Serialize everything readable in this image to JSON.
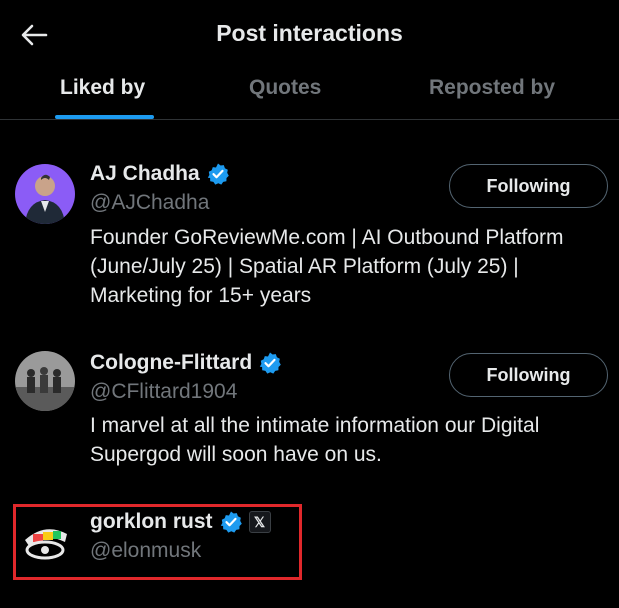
{
  "header": {
    "title": "Post interactions",
    "back_icon": "arrow-left-icon"
  },
  "tabs": [
    {
      "label": "Liked by",
      "active": true
    },
    {
      "label": "Quotes",
      "active": false
    },
    {
      "label": "Reposted by",
      "active": false
    }
  ],
  "users": [
    {
      "name": "AJ Chadha",
      "handle": "@AJChadha",
      "verified": true,
      "follow_label": "Following",
      "bio_lines": [
        "Founder GoReviewMe.com | AI Outbound Platform",
        "(June/July 25) | Spatial AR Platform (July 25) |",
        "Marketing for 15+ years"
      ]
    },
    {
      "name": "Cologne-Flittard",
      "handle": "@CFlittard1904",
      "verified": true,
      "follow_label": "Following",
      "bio_lines": [
        "I marvel at all the intimate information our Digital",
        "Supergod will soon have on us."
      ]
    },
    {
      "name": "gorklon rust",
      "handle": "@elonmusk",
      "verified": true,
      "affiliate_badge": "𝕏"
    }
  ],
  "colors": {
    "background": "#000000",
    "accent": "#1d9bf0",
    "muted": "#71767b",
    "highlight_box": "#e0282b"
  }
}
